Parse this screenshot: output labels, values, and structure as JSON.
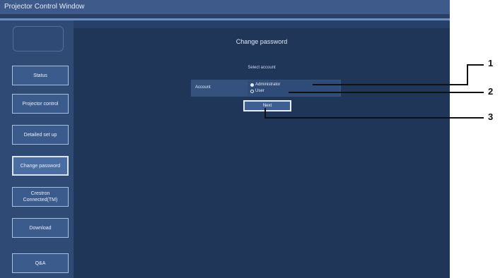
{
  "window": {
    "title": "Projector Control Window"
  },
  "sidebar": {
    "items": [
      {
        "label": "Status"
      },
      {
        "label": "Projector control"
      },
      {
        "label": "Detailed set up"
      },
      {
        "label": "Change password"
      },
      {
        "label": "Crestron Connected(TM)"
      },
      {
        "label": "Download"
      },
      {
        "label": "Q&A"
      }
    ],
    "active_index": 3
  },
  "main": {
    "title": "Change password",
    "section_label": "Select account",
    "account_label": "Account",
    "options": [
      {
        "label": "Administrator",
        "selected": true
      },
      {
        "label": "User",
        "selected": false
      }
    ],
    "next_label": "Next"
  },
  "callouts": [
    "1",
    "2",
    "3"
  ],
  "colors": {
    "window_bg": "#2a3f63",
    "main_bg": "#1f3659",
    "button_bg": "#3b5b8c"
  }
}
